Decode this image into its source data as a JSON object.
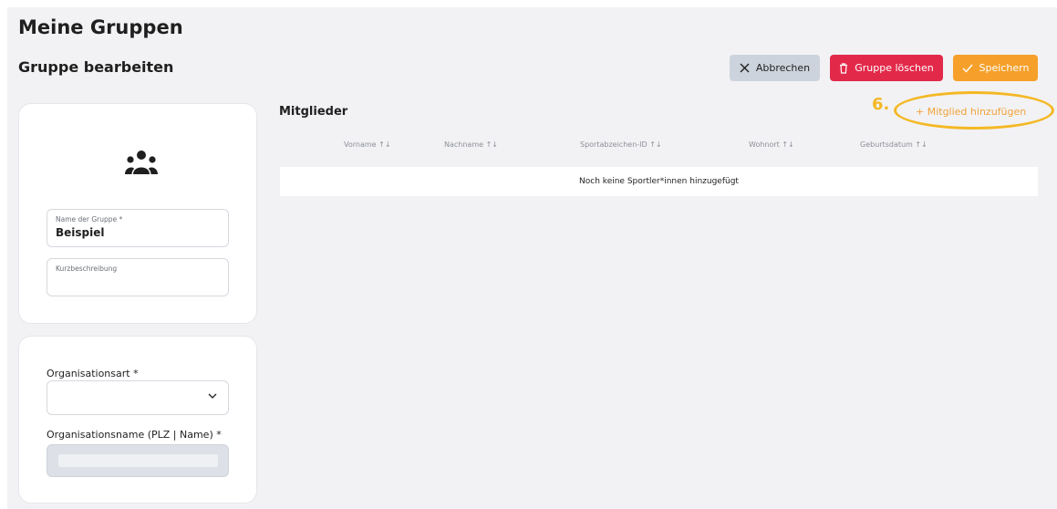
{
  "header": {
    "title": "Meine Gruppen",
    "subtitle": "Gruppe bearbeiten"
  },
  "toolbar": {
    "cancel_label": "Abbrechen",
    "delete_label": "Gruppe löschen",
    "save_label": "Speichern"
  },
  "group_form": {
    "icon": "group-icon",
    "name_label": "Name der Gruppe *",
    "name_value": "Beispiel",
    "description_label": "Kurzbeschreibung",
    "description_value": ""
  },
  "organisation": {
    "type_label": "Organisationsart *",
    "type_value": "",
    "name_label": "Organisationsname (PLZ | Name) *"
  },
  "members": {
    "title": "Mitglieder",
    "add_label": "+ Mitglied hinzufügen",
    "annotation": "6.",
    "columns": [
      "Vorname ↑↓",
      "Nachname ↑↓",
      "Sportabzeichen-ID ↑↓",
      "Wohnort ↑↓",
      "Geburtsdatum ↑↓"
    ],
    "empty_message": "Noch keine Sportler*innen hinzugefügt"
  },
  "colors": {
    "delete": "#e3294a",
    "save": "#f6a02b",
    "cancel": "#cdd3dc",
    "annotation": "#f4b824"
  }
}
